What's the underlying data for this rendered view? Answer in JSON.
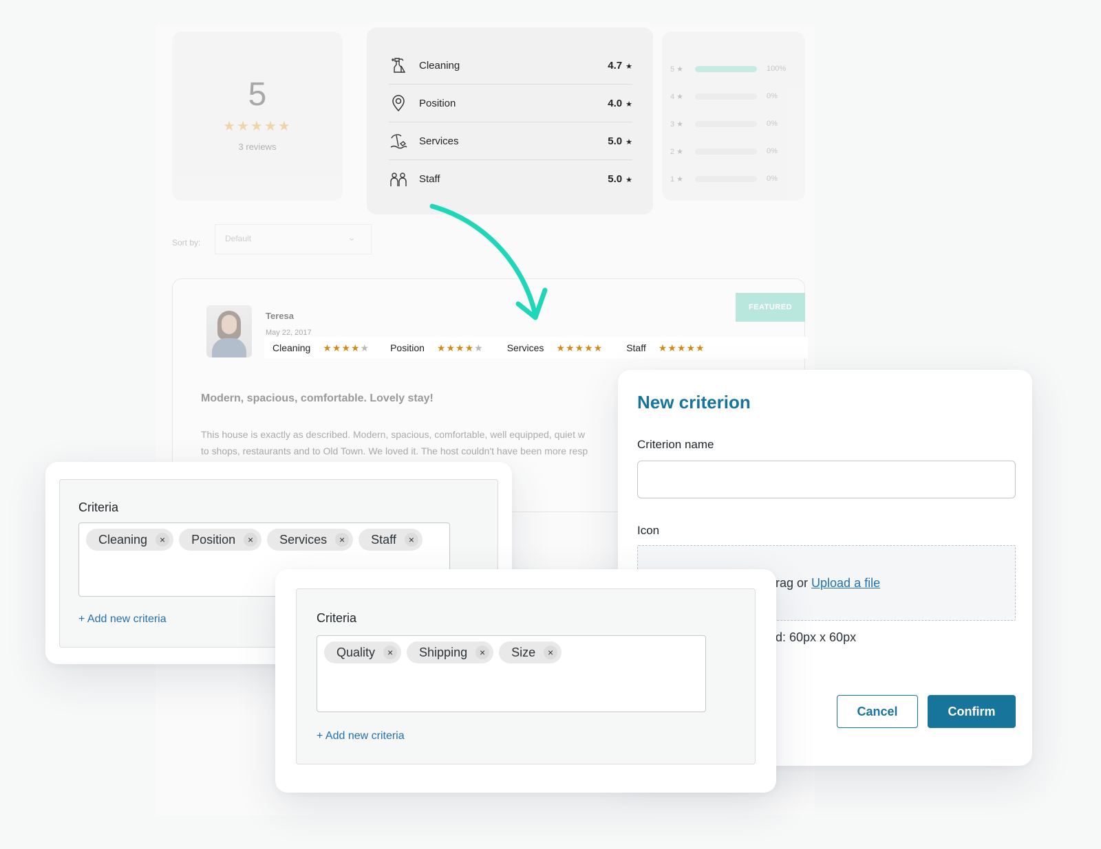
{
  "summary": {
    "score": "5",
    "stars": "★★★★★",
    "reviews": "3 reviews"
  },
  "criteria_scores": [
    {
      "name": "Cleaning",
      "score": "4.7",
      "icon": "cleaning-icon"
    },
    {
      "name": "Position",
      "score": "4.0",
      "icon": "location-pin-icon"
    },
    {
      "name": "Services",
      "score": "5.0",
      "icon": "beach-umbrella-icon"
    },
    {
      "name": "Staff",
      "score": "5.0",
      "icon": "staff-people-icon"
    }
  ],
  "star_glyph": "★",
  "distribution": [
    {
      "label": "5 ★",
      "percent": "100%",
      "fill": 1.0
    },
    {
      "label": "4 ★",
      "percent": "0%",
      "fill": 0
    },
    {
      "label": "3 ★",
      "percent": "0%",
      "fill": 0
    },
    {
      "label": "2 ★",
      "percent": "0%",
      "fill": 0
    },
    {
      "label": "1 ★",
      "percent": "0%",
      "fill": 0
    }
  ],
  "sort": {
    "label": "Sort by:",
    "value": "Default"
  },
  "review": {
    "author": "Teresa",
    "date": "May 22, 2017",
    "badge": "FEATURED",
    "ratings": [
      {
        "name": "Cleaning",
        "stars": 4
      },
      {
        "name": "Position",
        "stars": 4
      },
      {
        "name": "Services",
        "stars": 5
      },
      {
        "name": "Staff",
        "stars": 5
      }
    ],
    "title": "Modern, spacious, comfortable. Lovely stay!",
    "body_line1": "This house is exactly as described. Modern, spacious, comfortable, well equipped, quiet w",
    "body_line2": "to shops, restaurants and to Old Town. We loved it. The host couldn't have been more resp"
  },
  "criteria_panel_1": {
    "title": "Criteria",
    "tags": [
      "Cleaning",
      "Position",
      "Services",
      "Staff"
    ],
    "add_label": "+ Add new criteria"
  },
  "criteria_panel_2": {
    "title": "Criteria",
    "tags": [
      "Quality",
      "Shipping",
      "Size"
    ],
    "add_label": "+ Add new criteria"
  },
  "remove_glyph": "×",
  "modal": {
    "title": "New criterion",
    "name_label": "Criterion name",
    "name_value": "",
    "icon_label": "Icon",
    "upload_prefix": "rag or ",
    "upload_link": "Upload a file",
    "recommended": "d: 60px x 60px",
    "cancel_label": "Cancel",
    "confirm_label": "Confirm"
  },
  "colors": {
    "accent": "#17749a",
    "link": "#2271b1",
    "teal_arrow": "#1fd7b8",
    "star_gold": "#d18a1c"
  }
}
